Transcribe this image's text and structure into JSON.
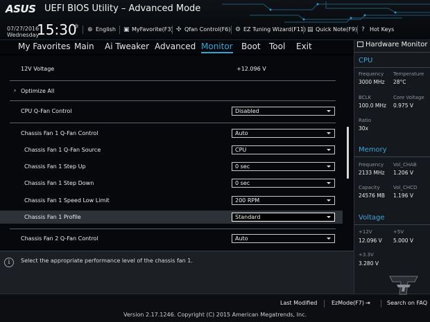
{
  "header": {
    "brand": "ASUS",
    "title": "UEFI BIOS Utility – Advanced Mode",
    "date": "07/27/2016",
    "day": "Wednesday",
    "time": "15:30",
    "tools": [
      {
        "icon": "globe-icon",
        "label": "English"
      },
      {
        "icon": "favorite-icon",
        "label": "MyFavorite(F3)"
      },
      {
        "icon": "fan-icon",
        "label": "Qfan Control(F6)"
      },
      {
        "icon": "tuning-icon",
        "label": "EZ Tuning Wizard(F11)"
      },
      {
        "icon": "note-icon",
        "label": "Quick Note(F9)"
      },
      {
        "icon": "help-icon",
        "label": "Hot Keys"
      }
    ]
  },
  "nav": {
    "tabs": [
      "My Favorites",
      "Main",
      "Ai Tweaker",
      "Advanced",
      "Monitor",
      "Boot",
      "Tool",
      "Exit"
    ],
    "active": "Monitor"
  },
  "settings": {
    "voltage_12v": {
      "label": "12V Voltage",
      "value": "+12.096 V"
    },
    "optimize_all": "Optimize All",
    "cpu_qfan": {
      "label": "CPU Q-Fan Control",
      "value": "Disabled"
    },
    "chassis1_qfan": {
      "label": "Chassis Fan 1 Q-Fan Control",
      "value": "Auto"
    },
    "chassis1_source": {
      "label": "Chassis Fan 1 Q-Fan Source",
      "value": "CPU"
    },
    "chassis1_stepup": {
      "label": "Chassis Fan 1 Step Up",
      "value": "0 sec"
    },
    "chassis1_stepdown": {
      "label": "Chassis Fan 1 Step Down",
      "value": "0 sec"
    },
    "chassis1_speedlow": {
      "label": "Chassis Fan 1 Speed Low Limit",
      "value": "200 RPM"
    },
    "chassis1_profile": {
      "label": "Chassis Fan 1 Profile",
      "value": "Standard"
    },
    "chassis2_qfan": {
      "label": "Chassis Fan 2 Q-Fan Control",
      "value": "Auto"
    }
  },
  "help": {
    "text": "Select the appropriate performance level of the chassis fan 1."
  },
  "hw_monitor": {
    "title": "Hardware Monitor",
    "cpu": {
      "section": "CPU",
      "freq_label": "Frequency",
      "freq": "3000 MHz",
      "temp_label": "Temperature",
      "temp": "28°C",
      "bclk_label": "BCLK",
      "bclk": "100.0 MHz",
      "corev_label": "Core Voltage",
      "corev": "0.975 V",
      "ratio_label": "Ratio",
      "ratio": "30x"
    },
    "memory": {
      "section": "Memory",
      "freq_label": "Frequency",
      "freq": "2133 MHz",
      "vchab_label": "Vol_CHAB",
      "vchab": "1.206 V",
      "cap_label": "Capacity",
      "cap": "24576 MB",
      "vchcd_label": "Vol_CHCD",
      "vchcd": "1.196 V"
    },
    "voltage": {
      "section": "Voltage",
      "v12_label": "+12V",
      "v12": "12.096 V",
      "v5_label": "+5V",
      "v5": "5.000 V",
      "v33_label": "+3.3V",
      "v33": "3.280 V"
    }
  },
  "footer": {
    "last_modified": "Last Modified",
    "ezmode": "EzMode(F7)",
    "search": "Search on FAQ",
    "version": "Version 2.17.1246. Copyright (C) 2015 American Megatrends, Inc."
  },
  "colors": {
    "accent": "#29a8de",
    "background": "#06080b",
    "panel": "#15181c",
    "selected_row": "#2d3238"
  }
}
